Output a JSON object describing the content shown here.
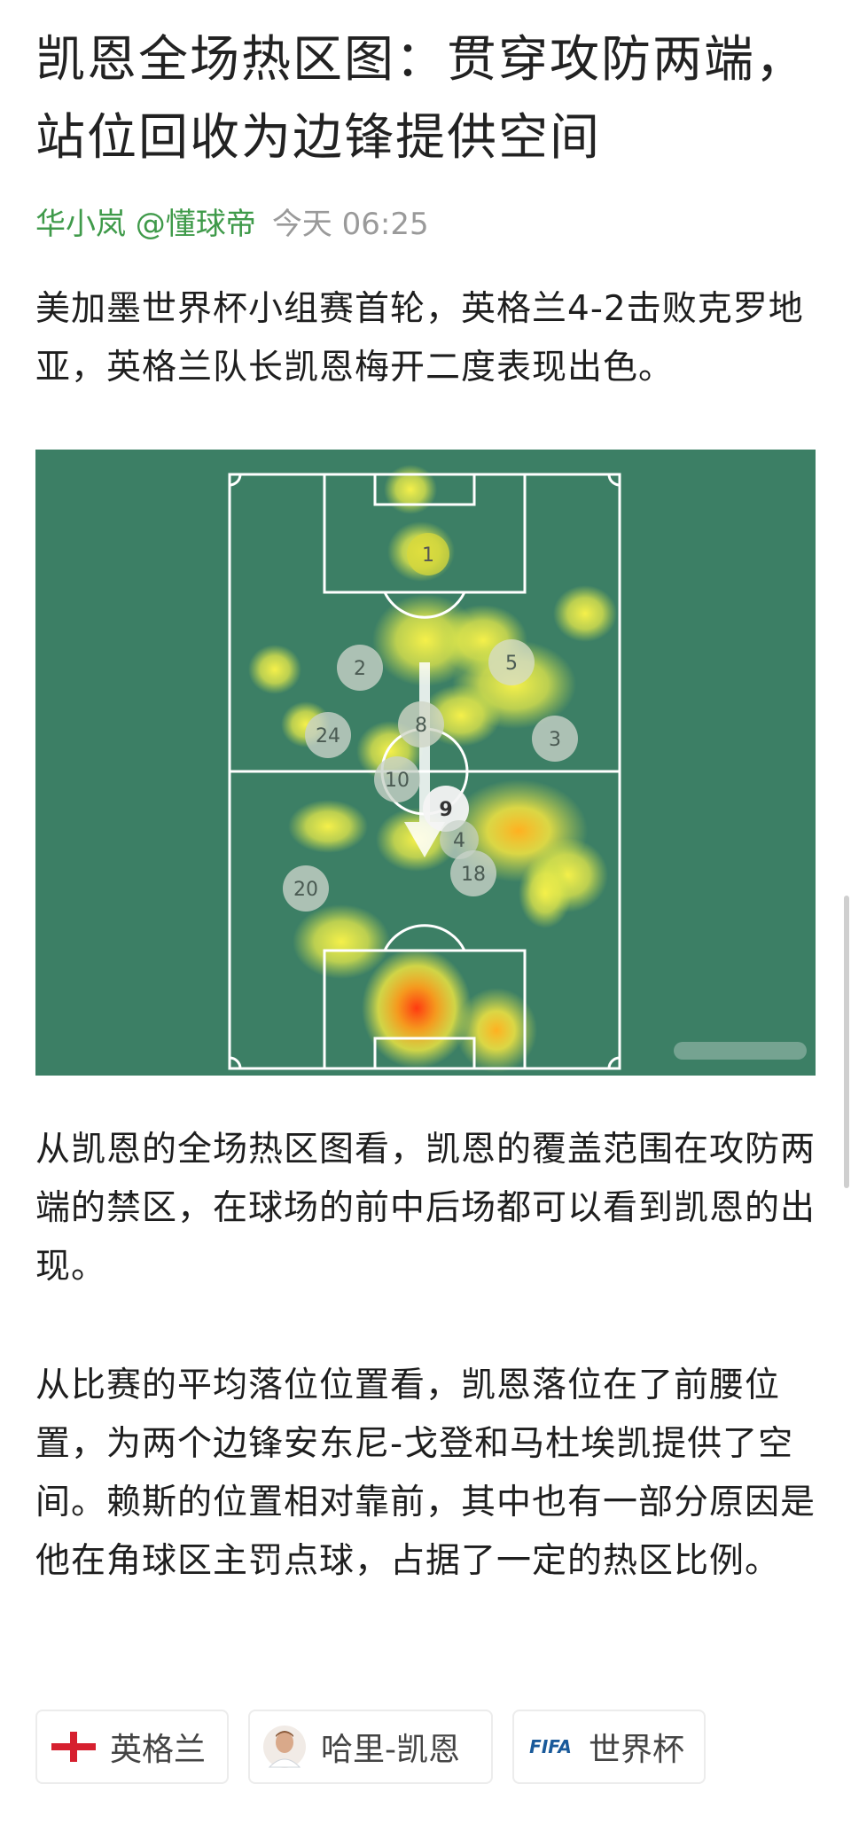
{
  "article": {
    "title": "凯恩全场热区图：贯穿攻防两端，站位回收为边锋提供空间",
    "author": "华小岚 @懂球帝",
    "time": "今天 06:25",
    "paragraphs": [
      "美加墨世界杯小组赛首轮，英格兰4-2击败克罗地亚，英格兰队长凯恩梅开二度表现出色。",
      "从凯恩的全场热区图看，凯恩的覆盖范围在攻防两端的禁区，在球场的前中后场都可以看到凯恩的出现。",
      "从比赛的平均落位位置看，凯恩落位在了前腰位置，为两个边锋安东尼-戈登和马杜埃凯提供了空间。赖斯的位置相对靠前，其中也有一部分原因是他在角球区主罚点球，占据了一定的热区比例。"
    ]
  },
  "heatmap": {
    "pitch_color": "#3c7f65",
    "player_numbers": [
      "1",
      "2",
      "5",
      "24",
      "8",
      "3",
      "10",
      "9",
      "4",
      "18",
      "20"
    ],
    "highlight_player": "9",
    "arrow_direction": "down"
  },
  "tags": [
    {
      "label": "英格兰",
      "icon": "england-flag-icon"
    },
    {
      "label": "哈里-凯恩",
      "icon": "player-avatar-icon"
    },
    {
      "label": "世界杯",
      "icon": "fifa-logo-icon",
      "logo_text": "FIFA"
    }
  ]
}
